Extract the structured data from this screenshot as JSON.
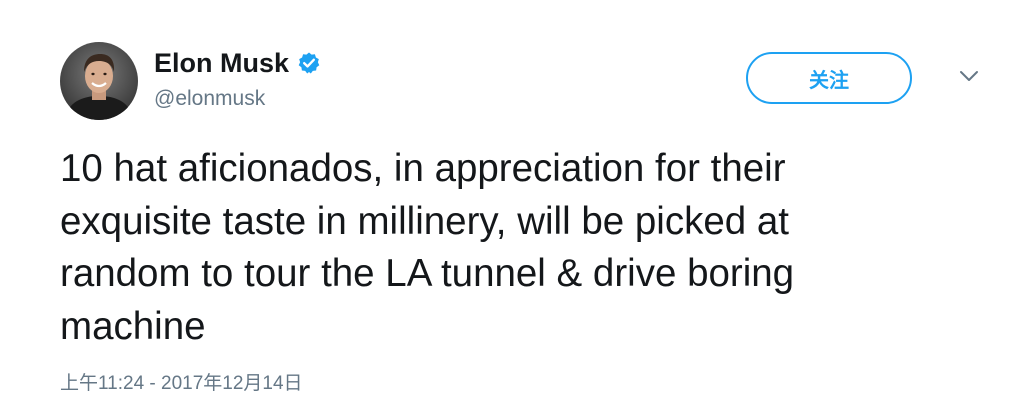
{
  "tweet": {
    "author": {
      "display_name": "Elon Musk",
      "handle": "@elonmusk",
      "verified": true
    },
    "follow_label": "关注",
    "text": "10 hat aficionados, in appreciation for their\nexquisite taste in millinery, will be picked at\nrandom to tour the LA tunnel & drive boring\nmachine",
    "timestamp": "上午11:24 - 2017年12月14日"
  },
  "colors": {
    "accent": "#1da1f2",
    "text": "#14171a",
    "secondary_text": "#657786"
  },
  "icons": {
    "verified": "verified-badge-icon",
    "more": "chevron-down-icon"
  }
}
